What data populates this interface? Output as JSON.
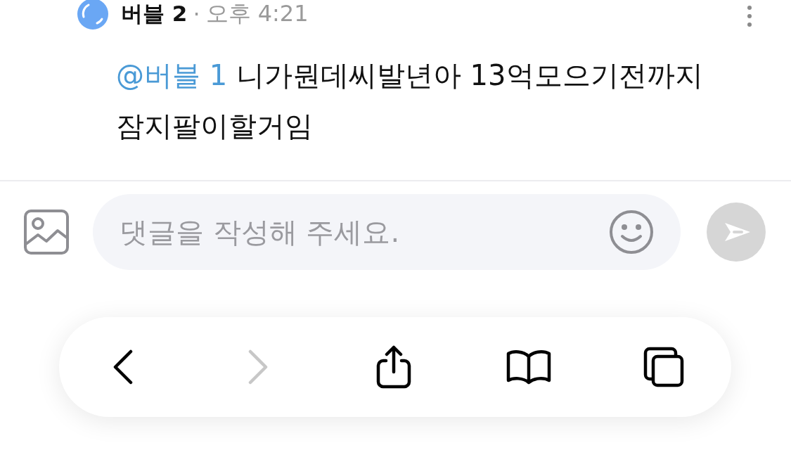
{
  "comment": {
    "author": "버블 2",
    "separator": "·",
    "time": "오후 4:21",
    "mention": "@버블 1",
    "text": "니가뭔데씨발년아 13억모으기전까지 잠지팔이할거임"
  },
  "comment_input": {
    "placeholder": "댓글을 작성해 주세요.",
    "send_disabled": true
  },
  "toolbar": {
    "items": [
      {
        "kind": "back",
        "disabled": false
      },
      {
        "kind": "forward",
        "disabled": true
      },
      {
        "kind": "share",
        "disabled": false
      },
      {
        "kind": "bookmarks",
        "disabled": false
      },
      {
        "kind": "tabs",
        "disabled": false
      }
    ]
  }
}
